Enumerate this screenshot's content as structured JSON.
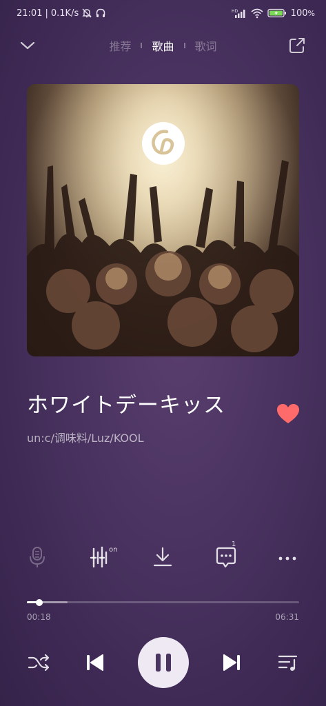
{
  "status_bar": {
    "time": "21:01",
    "net_speed": "0.1K/s",
    "battery": "100",
    "battery_suffix": "%",
    "icons": [
      "mute-bell-icon",
      "headphones-icon",
      "hd-signal-icon",
      "wifi-icon",
      "battery-charging-icon"
    ]
  },
  "header": {
    "tabs": [
      {
        "label": "推荐",
        "active": false
      },
      {
        "label": "歌曲",
        "active": true
      },
      {
        "label": "歌词",
        "active": false
      }
    ],
    "icons": {
      "collapse": "chevron-down-icon",
      "share": "share-external-icon"
    }
  },
  "cover": {
    "icon": "netease-music-logo-icon"
  },
  "song": {
    "title": "ホワイトデーキッス",
    "artist": "un:c/调味料/Luz/KOOL",
    "liked": true
  },
  "actions": {
    "audio_effect_badge": "on",
    "comment_count": "1",
    "icons": [
      "karaoke-mic-icon",
      "audio-effect-icon",
      "download-icon",
      "comment-icon",
      "more-icon"
    ]
  },
  "playback": {
    "current_time": "00:18",
    "total_time": "06:31",
    "progress": 0.046,
    "buffered": 0.15,
    "state": "playing"
  },
  "controls": {
    "icons": [
      "shuffle-icon",
      "previous-icon",
      "pause-icon",
      "next-icon",
      "playlist-icon"
    ]
  },
  "colors": {
    "background": "#4d3563",
    "like": "#ff6b6b",
    "play_button": "#efe9f4",
    "pause_glyph": "#4a3560"
  }
}
